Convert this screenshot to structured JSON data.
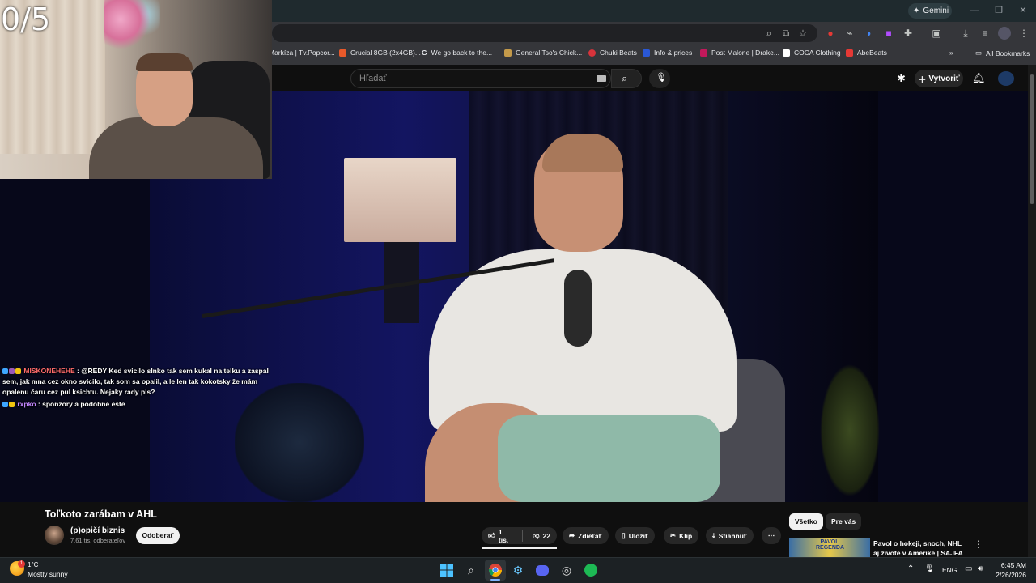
{
  "overlay": {
    "counter": "0/5",
    "chat": [
      {
        "user": "MISKONEHEHE",
        "message": ": @REDY Ked svicilo slnko tak sem kukal na telku a zaspal sem, jak mna cez okno svicilo, tak som sa opalil, a le len tak kokotsky že mám opalenu čaru cez pul ksichtu. Nejaky rady pls?"
      },
      {
        "user": "rxpko",
        "message": ": sponzory a podobne ešte"
      }
    ]
  },
  "browser": {
    "gemini_label": "Gemini",
    "bookmarks": [
      {
        "label": "Markíza | Tv.Popcor...",
        "color": "#ffffff"
      },
      {
        "label": "Crucial 8GB (2x4GB)...",
        "color": "#e8592a"
      },
      {
        "label": "We go back to the...",
        "color": "#ffffff"
      },
      {
        "label": "General Tso's Chick...",
        "color": "#c49a4a"
      },
      {
        "label": "Chuki Beats",
        "color": "#d8333b"
      },
      {
        "label": "Info & prices",
        "color": "#2a58d6"
      },
      {
        "label": "Post Malone | Drake...",
        "color": "#c2185b"
      },
      {
        "label": "COCA Clothing",
        "color": "#ffffff"
      },
      {
        "label": "AbeBeats",
        "color": "#e53935"
      }
    ],
    "all_bookmarks": "All Bookmarks"
  },
  "youtube": {
    "search_placeholder": "Hľadať",
    "create_label": "Vytvoriť",
    "video_title": "Toľkoto zarábam v AHL",
    "channel_name": "(p)opičí biznis",
    "subscribers": "7,61 tis. odberateľov",
    "subscribe_label": "Odoberať",
    "likes": "1 tis.",
    "dislikes": "22",
    "share_label": "Zdieľať",
    "save_label": "Uložiť",
    "clip_label": "Klip",
    "download_label": "Stiahnuť",
    "filter_all": "Všetko",
    "filter_for_you": "Pre vás",
    "rec_title": "Pavol o hokeji, snoch, NHL aj živote v Amerike | SAJFA ŠOU",
    "rec_thumb_text": "PAVOL REGENDA"
  },
  "taskbar": {
    "temperature": "1°C",
    "weather": "Mostly sunny",
    "weather_badge": "1",
    "language": "ENG",
    "time": "6:45 AM",
    "date": "2/26/2026"
  }
}
